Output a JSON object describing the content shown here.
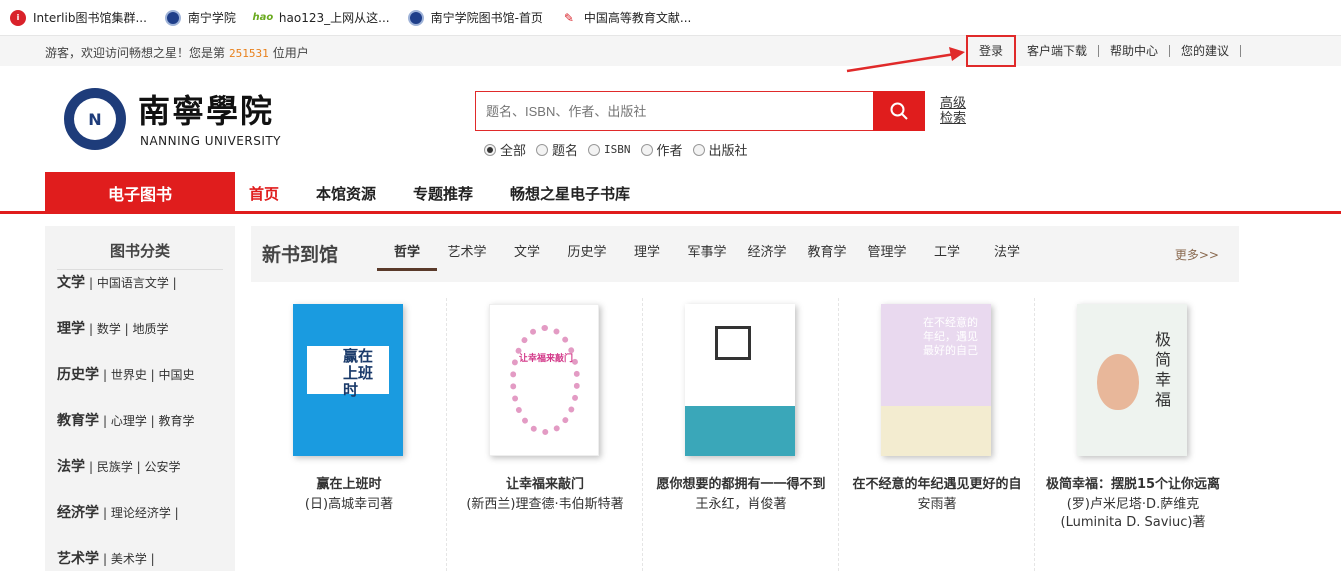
{
  "bookmarks": [
    {
      "label": "Interlib图书馆集群...",
      "icon": "interlib-icon"
    },
    {
      "label": "南宁学院",
      "icon": "nanning-university-icon"
    },
    {
      "label": "hao123_上网从这...",
      "icon": "hao123-icon"
    },
    {
      "label": "南宁学院图书馆-首页",
      "icon": "nanning-university-icon"
    },
    {
      "label": "中国高等教育文献...",
      "icon": "pdf-icon"
    }
  ],
  "topbar": {
    "welcome_prefix": "游客，欢迎访问畅想之星！您是第",
    "visitor_count": "251531",
    "welcome_suffix": "位用户",
    "login": "登录",
    "client_download": "客户端下载",
    "help": "帮助中心",
    "feedback": "您的建议"
  },
  "header": {
    "logo_cn": "南寧學院",
    "logo_en": "NANNING UNIVERSITY",
    "search_placeholder": "题名、ISBN、作者、出版社",
    "advanced_search": "高级检索",
    "radio_options": [
      "全部",
      "题名",
      "ISBN",
      "作者",
      "出版社"
    ],
    "radio_selected": "全部"
  },
  "nav": {
    "ebook": "电子图书",
    "items": [
      "首页",
      "本馆资源",
      "专题推荐",
      "畅想之星电子书库"
    ],
    "active": "首页"
  },
  "sidebar": {
    "title": "图书分类",
    "categories": [
      {
        "main": "文学",
        "subs": "| 中国语言文学 |"
      },
      {
        "main": "理学",
        "subs": "| 数学 | 地质学"
      },
      {
        "main": "历史学",
        "subs": "| 世界史 | 中国史"
      },
      {
        "main": "教育学",
        "subs": "| 心理学 | 教育学"
      },
      {
        "main": "法学",
        "subs": "| 民族学 | 公安学"
      },
      {
        "main": "经济学",
        "subs": "| 理论经济学 |"
      },
      {
        "main": "艺术学",
        "subs": "| 美术学 |"
      }
    ]
  },
  "new_books": {
    "title": "新书到馆",
    "tabs": [
      "哲学",
      "艺术学",
      "文学",
      "历史学",
      "理学",
      "军事学",
      "经济学",
      "教育学",
      "管理学",
      "工学",
      "法学"
    ],
    "active_tab": "哲学",
    "more": "更多>>",
    "books": [
      {
        "title": "赢在上班时",
        "author": "(日)高城幸司著",
        "cover_text": "赢在上班时"
      },
      {
        "title": "让幸福来敲门",
        "author": "(新西兰)理查德·韦伯斯特著",
        "cover_text": "让幸福来敲门"
      },
      {
        "title": "愿你想要的都拥有一一得不到",
        "author": "王永红，肖俊著",
        "cover_text": ""
      },
      {
        "title": "在不经意的年纪遇见更好的自",
        "author": "安雨著",
        "cover_text": "在不经意的年纪，遇见最好的自己"
      },
      {
        "title": "极简幸福：摆脱15个让你远离",
        "author": "(罗)卢米尼塔·D.萨维克(Luminita D. Saviuc)著",
        "cover_text": "极简幸福"
      }
    ]
  }
}
